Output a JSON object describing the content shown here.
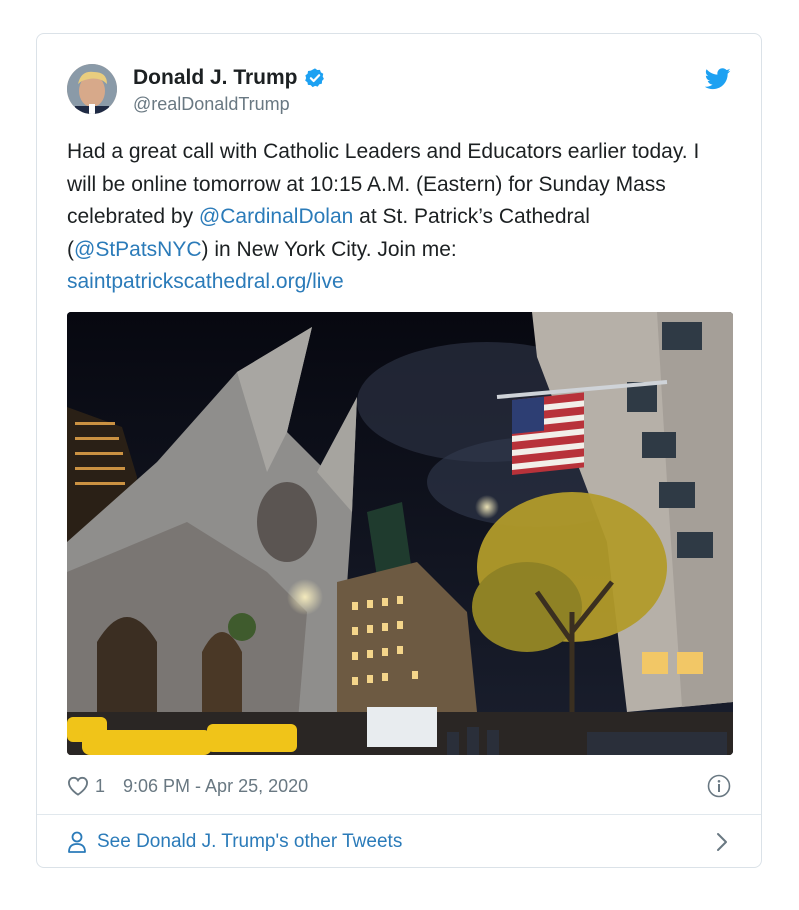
{
  "tweet": {
    "author_name": "Donald J. Trump",
    "author_handle": "@realDonaldTrump",
    "verified": true,
    "text_parts": {
      "p1": "Had a great call with Catholic Leaders and Educators earlier today. I will be online tomorrow at 10:15 A.M. (Eastern) for Sunday Mass celebrated by ",
      "mention1": "@CardinalDolan",
      "p2": " at St. Patrick’s Cathedral (",
      "mention2": "@StPatsNYC",
      "p3": ") in New York City. Join me: ",
      "url": "saintpatrickscathedral.org/live"
    },
    "likes": "1",
    "timestamp": "9:06 PM - Apr 25, 2020"
  },
  "footer": {
    "see_more_label": "See Donald J. Trump's other Tweets"
  },
  "icons": {
    "brand": "twitter-bird-icon",
    "verified": "verified-badge-icon",
    "like": "heart-icon",
    "info": "info-icon",
    "person": "person-icon",
    "chevron": "chevron-right-icon"
  },
  "colors": {
    "link": "#2b7bb9",
    "twitter_blue": "#1da1f2",
    "secondary_text": "#697882",
    "border": "#dbe2e8"
  }
}
